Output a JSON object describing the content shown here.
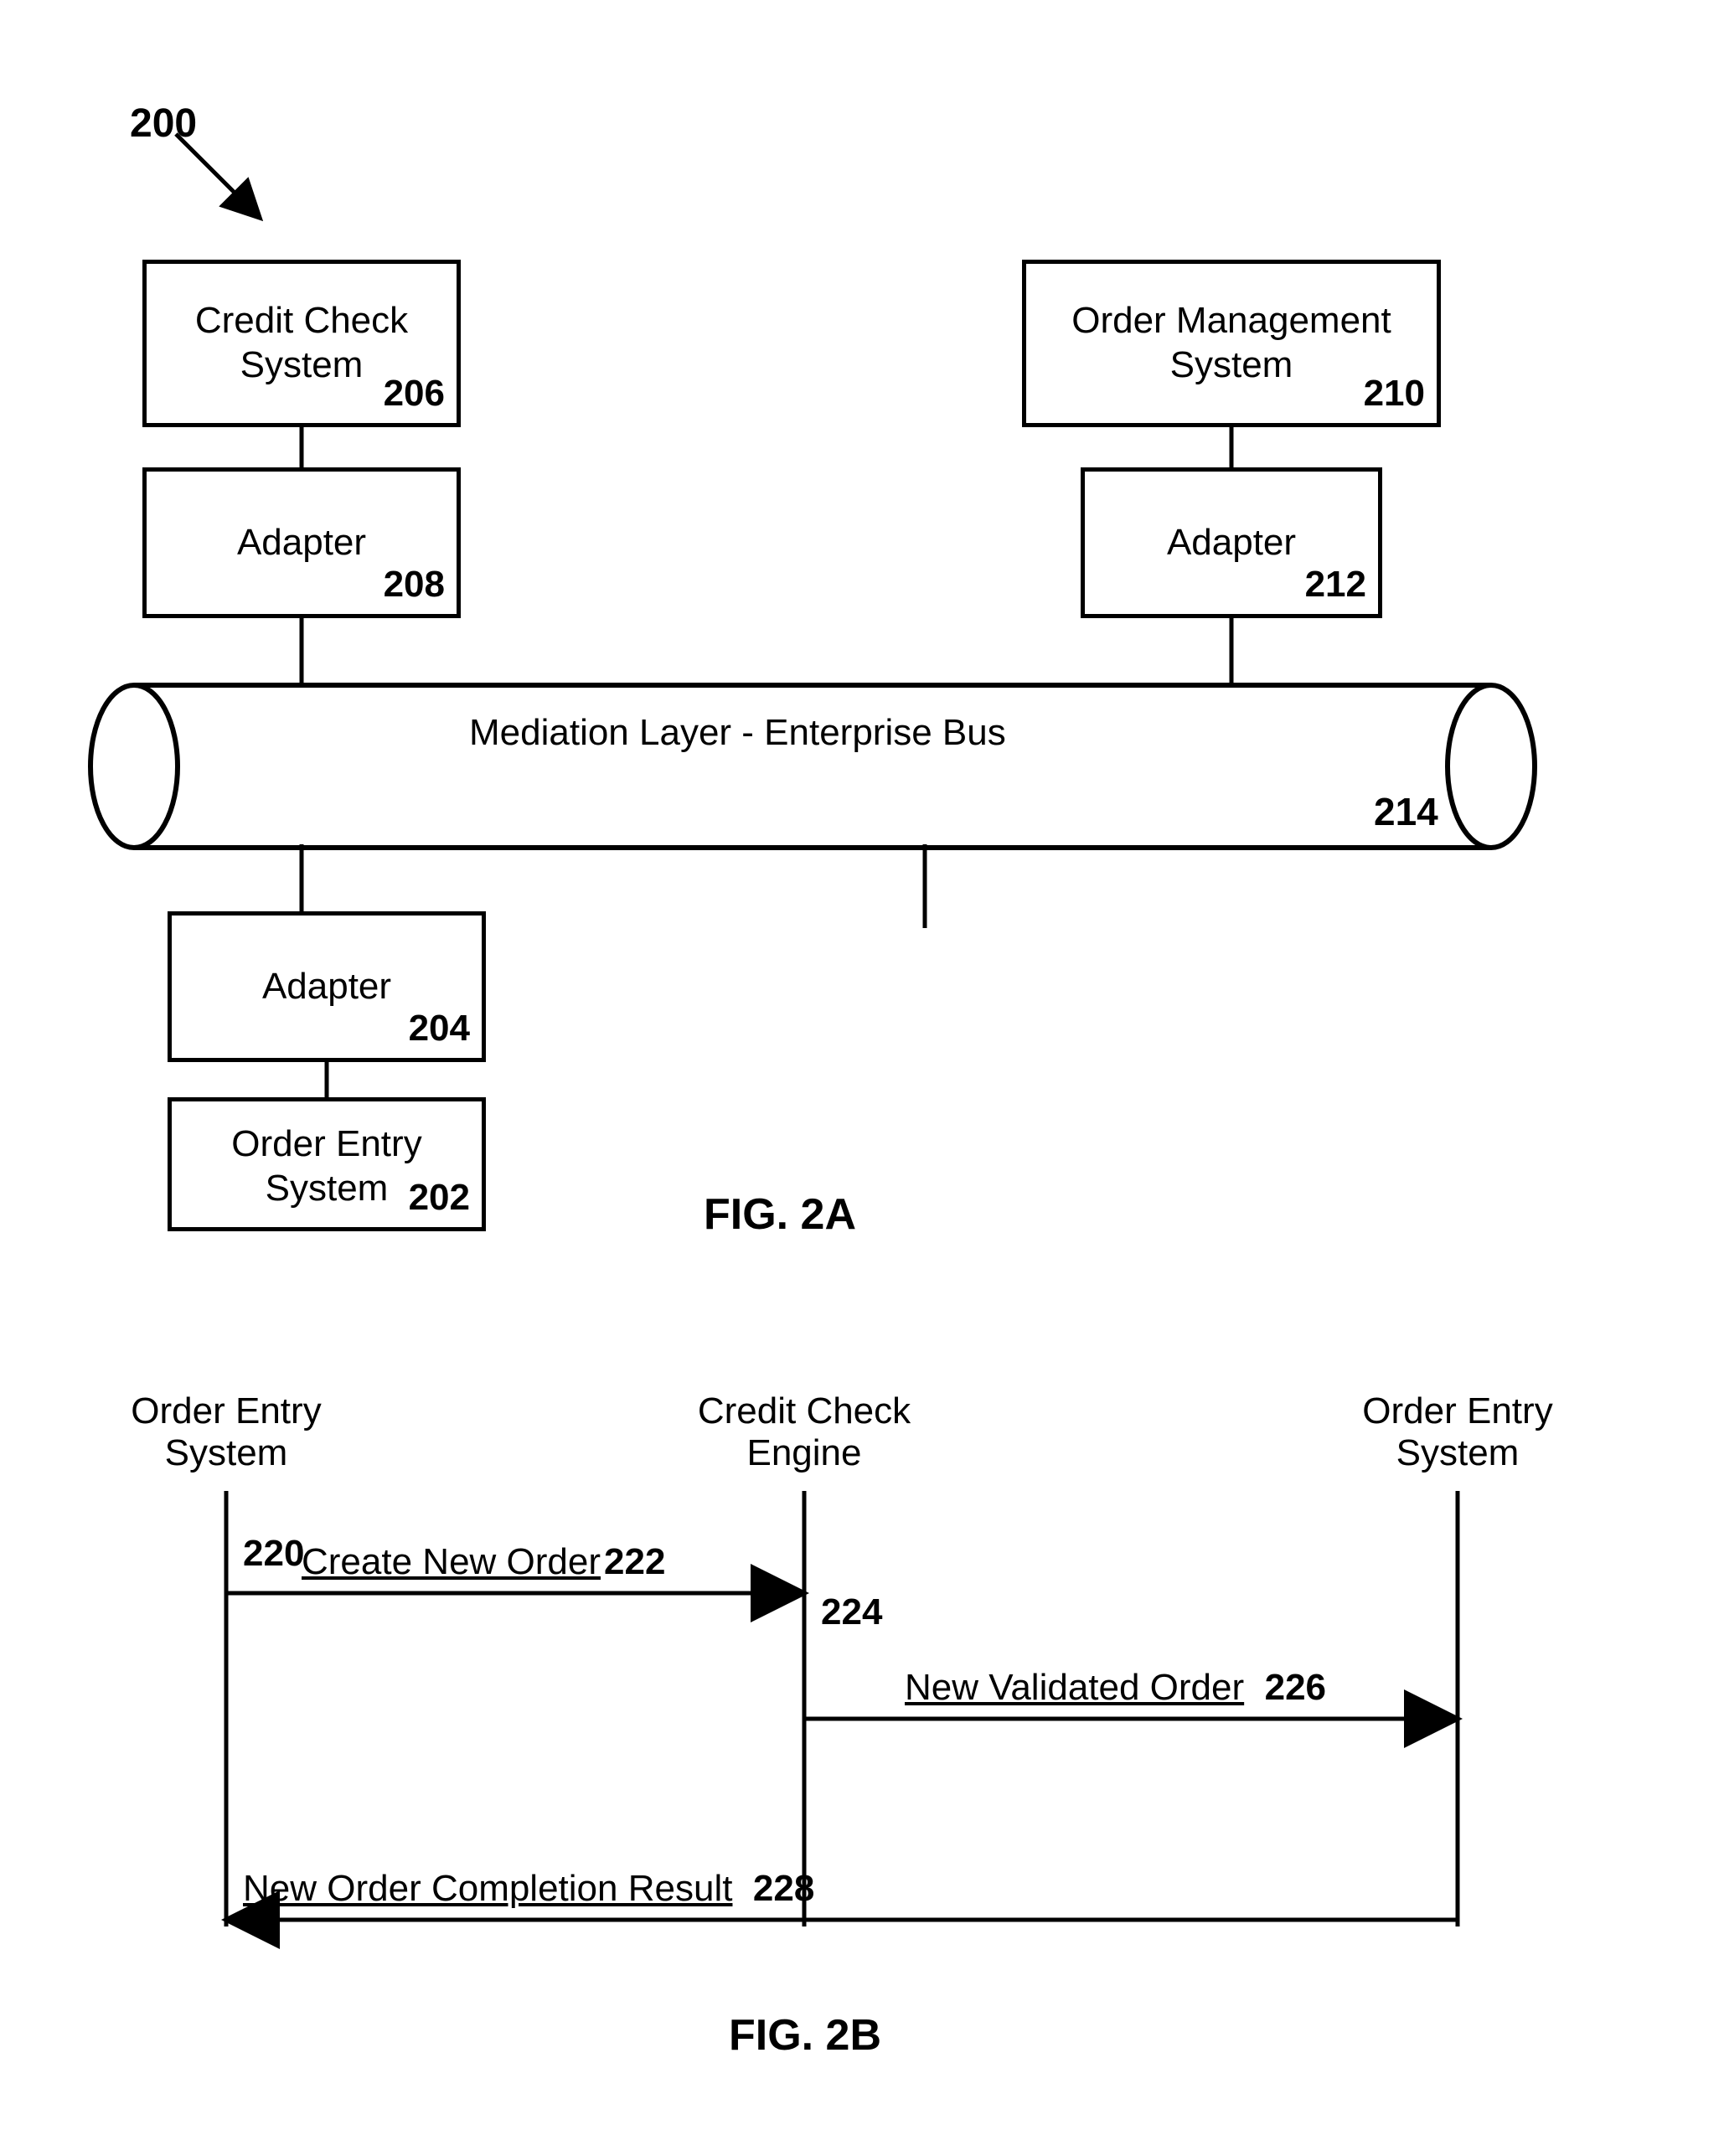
{
  "fig2a": {
    "ref_overall": "200",
    "credit_check": {
      "label_l1": "Credit Check",
      "label_l2": "System",
      "ref": "206"
    },
    "adapter_cc": {
      "label": "Adapter",
      "ref": "208"
    },
    "order_mgmt": {
      "label_l1": "Order Management",
      "label_l2": "System",
      "ref": "210"
    },
    "adapter_om": {
      "label": "Adapter",
      "ref": "212"
    },
    "bus": {
      "label": "Mediation Layer - Enterprise Bus",
      "ref": "214"
    },
    "adapter_oe": {
      "label": "Adapter",
      "ref": "204"
    },
    "order_entry": {
      "label_l1": "Order Entry",
      "label_l2": "System",
      "ref": "202"
    },
    "caption": "FIG. 2A"
  },
  "fig2b": {
    "oe_left": {
      "label_l1": "Order Entry",
      "label_l2": "System",
      "ref": "220"
    },
    "cc_engine": {
      "label_l1": "Credit Check",
      "label_l2": "Engine",
      "ref": "224"
    },
    "oe_right": {
      "label_l1": "Order Entry",
      "label_l2": "System"
    },
    "msg_create": {
      "text": "Create New Order",
      "ref": "222"
    },
    "msg_validated": {
      "text": "New Validated Order",
      "ref": "226"
    },
    "msg_result": {
      "text": "New Order Completion Result",
      "ref": "228"
    },
    "caption": "FIG. 2B"
  }
}
